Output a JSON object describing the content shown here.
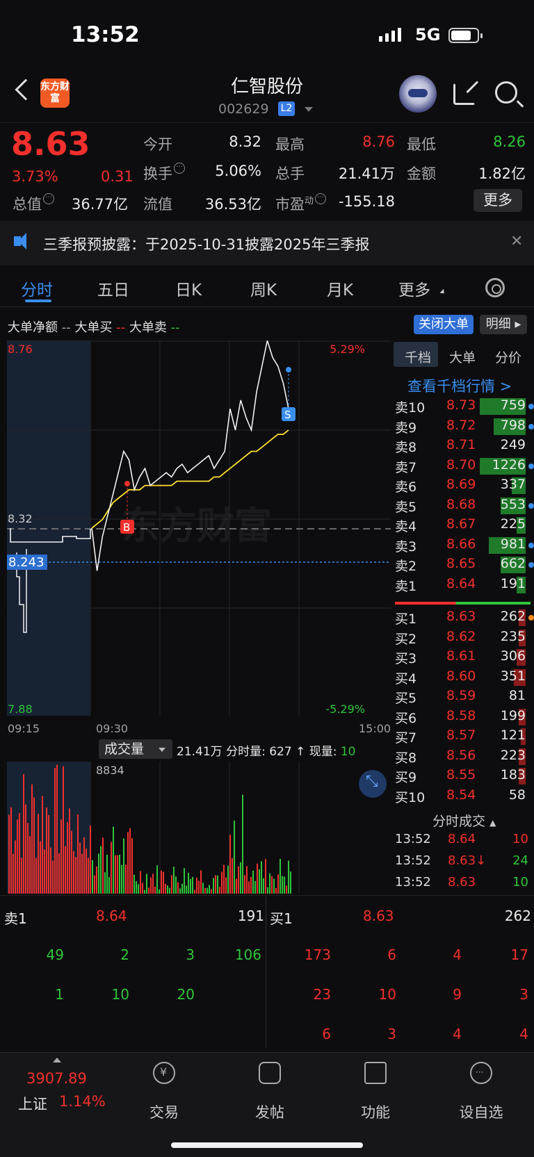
{
  "status": {
    "time": "13:52",
    "network": "5G"
  },
  "header": {
    "logo": "东方财富",
    "stock_name": "仁智股份",
    "stock_code": "002629",
    "level": "L2"
  },
  "quote": {
    "price": "8.63",
    "pct": "3.73%",
    "change": "0.31",
    "total_value_label": "总值",
    "total_value": "36.77亿",
    "open_label": "今开",
    "open": "8.32",
    "high_label": "最高",
    "high": "8.76",
    "low_label": "最低",
    "low": "8.26",
    "turnover_label": "换手",
    "turnover": "5.06%",
    "volume_label": "总手",
    "volume": "21.41万",
    "amount_label": "金额",
    "amount": "1.82亿",
    "float_label": "流值",
    "float_value": "36.53亿",
    "pe_label": "市盈",
    "pe_sup": "动",
    "pe": "-155.18",
    "more": "更多"
  },
  "notice": {
    "text": "三季报预披露：于2025-10-31披露2025年三季报"
  },
  "tabs": [
    "分时",
    "五日",
    "日K",
    "周K",
    "月K",
    "更多"
  ],
  "legend": {
    "net": "大单净额",
    "buy": "大单买",
    "sell": "大单卖",
    "close_btn": "关闭大单",
    "detail_btn": "明细"
  },
  "chart_data": {
    "type": "line",
    "y_max": "8.76",
    "y_min": "7.88",
    "y_ref": "8.32",
    "y_cursor": "8.243",
    "pct_max": "5.29%",
    "pct_min": "-5.29%",
    "x_labels": [
      "09:15",
      "09:30",
      "15:00"
    ],
    "watermark": "东方财富",
    "markers": [
      "B",
      "S"
    ],
    "series": [
      {
        "name": "price",
        "values": [
          8.32,
          8.22,
          8.3,
          8.35,
          8.4,
          8.45,
          8.5,
          8.48,
          8.41,
          8.44,
          8.46,
          8.42,
          8.43,
          8.44,
          8.45,
          8.44,
          8.46,
          8.47,
          8.45,
          8.46,
          8.47,
          8.48,
          8.49,
          8.46,
          8.48,
          8.5,
          8.6,
          8.55,
          8.62,
          8.58,
          8.55,
          8.64,
          8.7,
          8.76,
          8.72,
          8.7,
          8.66,
          8.6
        ]
      },
      {
        "name": "avg",
        "values": [
          8.32,
          8.33,
          8.34,
          8.36,
          8.38,
          8.39,
          8.4,
          8.41,
          8.41,
          8.41,
          8.42,
          8.42,
          8.42,
          8.42,
          8.42,
          8.42,
          8.43,
          8.43,
          8.43,
          8.43,
          8.43,
          8.43,
          8.43,
          8.44,
          8.44,
          8.45,
          8.46,
          8.47,
          8.48,
          8.49,
          8.5,
          8.5,
          8.51,
          8.52,
          8.53,
          8.54,
          8.54,
          8.55
        ]
      }
    ]
  },
  "volume": {
    "selector": "成交量",
    "info": "21.41万 分时量: 627 ↑ 现量: ",
    "now": "10",
    "peak": "8834"
  },
  "right_panel": {
    "tabs": [
      "千档",
      "大单",
      "分价"
    ],
    "link": "查看千档行情 >",
    "asks": [
      {
        "label": "卖10",
        "price": "8.73",
        "vol": "759",
        "bar": 1.0,
        "dot": "#3a8ef0"
      },
      {
        "label": "卖9",
        "price": "8.72",
        "vol": "798",
        "bar": 0.7,
        "dot": "#3a8ef0"
      },
      {
        "label": "卖8",
        "price": "8.71",
        "vol": "249",
        "bar": 0.0,
        "dot": ""
      },
      {
        "label": "卖7",
        "price": "8.70",
        "vol": "1226",
        "bar": 1.0,
        "dot": "#3a8ef0"
      },
      {
        "label": "卖6",
        "price": "8.69",
        "vol": "337",
        "bar": 0.3,
        "dot": ""
      },
      {
        "label": "卖5",
        "price": "8.68",
        "vol": "553",
        "bar": 0.55,
        "dot": "#3a8ef0"
      },
      {
        "label": "卖4",
        "price": "8.67",
        "vol": "225",
        "bar": 0.2,
        "dot": ""
      },
      {
        "label": "卖3",
        "price": "8.66",
        "vol": "981",
        "bar": 0.8,
        "dot": "#3a8ef0"
      },
      {
        "label": "卖2",
        "price": "8.65",
        "vol": "662",
        "bar": 0.55,
        "dot": "#3a8ef0"
      },
      {
        "label": "卖1",
        "price": "8.64",
        "vol": "191",
        "bar": 0.2,
        "dot": ""
      }
    ],
    "bids": [
      {
        "label": "买1",
        "price": "8.63",
        "vol": "262",
        "bar": 0.15,
        "dot": "#ff8a1a"
      },
      {
        "label": "买2",
        "price": "8.62",
        "vol": "235",
        "bar": 0.15,
        "dot": ""
      },
      {
        "label": "买3",
        "price": "8.61",
        "vol": "306",
        "bar": 0.2,
        "dot": ""
      },
      {
        "label": "买4",
        "price": "8.60",
        "vol": "351",
        "bar": 0.25,
        "dot": ""
      },
      {
        "label": "买5",
        "price": "8.59",
        "vol": "81",
        "bar": 0.0,
        "dot": ""
      },
      {
        "label": "买6",
        "price": "8.58",
        "vol": "199",
        "bar": 0.15,
        "dot": ""
      },
      {
        "label": "买7",
        "price": "8.57",
        "vol": "121",
        "bar": 0.1,
        "dot": ""
      },
      {
        "label": "买8",
        "price": "8.56",
        "vol": "223",
        "bar": 0.15,
        "dot": ""
      },
      {
        "label": "买9",
        "price": "8.55",
        "vol": "183",
        "bar": 0.15,
        "dot": ""
      },
      {
        "label": "买10",
        "price": "8.54",
        "vol": "58",
        "bar": 0.0,
        "dot": ""
      }
    ],
    "ticks_title": "分时成交",
    "ticks": [
      {
        "time": "13:52",
        "price": "8.64",
        "vol": "10",
        "vcolor": "#f2302d"
      },
      {
        "time": "13:52",
        "price": "8.63↓",
        "vol": "24",
        "vcolor": "#2fc53b"
      },
      {
        "time": "13:52",
        "price": "8.63",
        "vol": "10",
        "vcolor": "#2fc53b"
      }
    ]
  },
  "book": {
    "sell_label": "卖1",
    "sell_price": "8.64",
    "sell_vol": "191",
    "buy_label": "买1",
    "buy_price": "8.63",
    "buy_vol": "262",
    "sell_rows": [
      [
        "49",
        "2",
        "3",
        "106"
      ],
      [
        "1",
        "10",
        "20",
        ""
      ]
    ],
    "buy_rows": [
      [
        "173",
        "6",
        "4",
        "17"
      ],
      [
        "23",
        "10",
        "9",
        "3"
      ],
      [
        "6",
        "3",
        "4",
        "4"
      ]
    ]
  },
  "nav": {
    "index_value": "3907.89",
    "index_name": "上证",
    "index_pct": "1.14%",
    "items": [
      "交易",
      "发帖",
      "功能",
      "设自选"
    ]
  }
}
